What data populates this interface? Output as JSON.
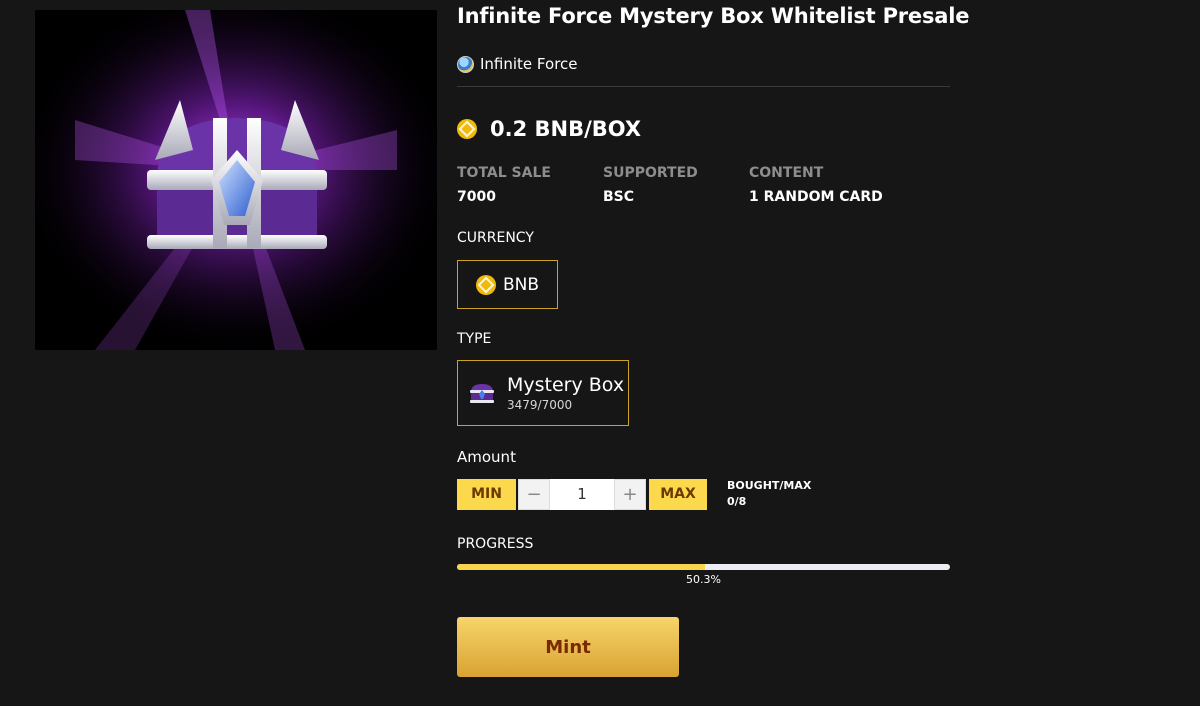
{
  "product": {
    "title": "Infinite Force Mystery Box Whitelist Presale",
    "creator": "Infinite Force",
    "price": "0.2 BNB/BOX"
  },
  "stats": [
    {
      "label": "TOTAL SALE",
      "value": "7000"
    },
    {
      "label": "SUPPORTED",
      "value": "BSC"
    },
    {
      "label": "CONTENT",
      "value": "1 RANDOM CARD"
    }
  ],
  "currency": {
    "label": "CURRENCY",
    "option": "BNB"
  },
  "type": {
    "label": "TYPE",
    "name": "Mystery Box",
    "count": "3479/7000"
  },
  "amount": {
    "label": "Amount",
    "min_label": "MIN",
    "max_label": "MAX",
    "minus": "−",
    "plus": "+",
    "value": "1",
    "bought_label": "BOUGHT/MAX",
    "bought_value": "0/8"
  },
  "progress": {
    "label": "PROGRESS",
    "percent": 50.3,
    "text": "50.3%"
  },
  "mint_label": "Mint",
  "colors": {
    "accent": "#fcd84c",
    "border": "#c9a227",
    "background": "#161616"
  }
}
